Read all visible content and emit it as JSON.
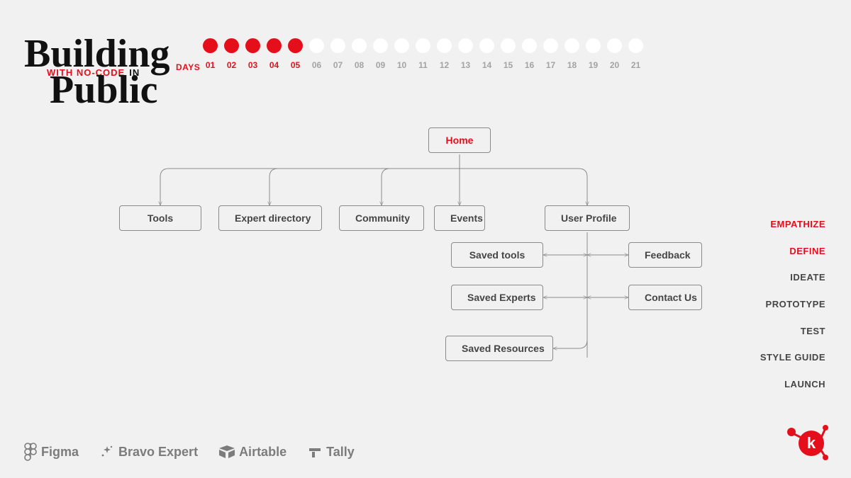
{
  "logo": {
    "line1": "Building",
    "with_nocode": "WITH NO-CODE",
    "in": "IN",
    "line2": "Public"
  },
  "days": {
    "caption": "DAYS",
    "items": [
      {
        "num": "01",
        "active": true
      },
      {
        "num": "02",
        "active": true
      },
      {
        "num": "03",
        "active": true
      },
      {
        "num": "04",
        "active": true
      },
      {
        "num": "05",
        "active": true
      },
      {
        "num": "06",
        "active": false
      },
      {
        "num": "07",
        "active": false
      },
      {
        "num": "08",
        "active": false
      },
      {
        "num": "09",
        "active": false
      },
      {
        "num": "10",
        "active": false
      },
      {
        "num": "11",
        "active": false
      },
      {
        "num": "12",
        "active": false
      },
      {
        "num": "13",
        "active": false
      },
      {
        "num": "14",
        "active": false
      },
      {
        "num": "15",
        "active": false
      },
      {
        "num": "16",
        "active": false
      },
      {
        "num": "17",
        "active": false
      },
      {
        "num": "18",
        "active": false
      },
      {
        "num": "19",
        "active": false
      },
      {
        "num": "20",
        "active": false
      },
      {
        "num": "21",
        "active": false
      }
    ]
  },
  "phases": [
    {
      "label": "EMPATHIZE",
      "active": true
    },
    {
      "label": "DEFINE",
      "active": true
    },
    {
      "label": "IDEATE",
      "active": false
    },
    {
      "label": "PROTOTYPE",
      "active": false
    },
    {
      "label": "TEST",
      "active": false
    },
    {
      "label": "STYLE GUIDE",
      "active": false
    },
    {
      "label": "LAUNCH",
      "active": false
    }
  ],
  "diagram": {
    "root": "Home",
    "level1": {
      "tools": "Tools",
      "experts": "Expert directory",
      "community": "Community",
      "events": "Events",
      "user_profile": "User Profile"
    },
    "user_profile_children": {
      "saved_tools": "Saved tools",
      "feedback": "Feedback",
      "saved_experts": "Saved Experts",
      "contact_us": "Contact Us",
      "saved_resources": "Saved Resources"
    }
  },
  "footer_tools": {
    "figma": "Figma",
    "bravo": "Bravo Expert",
    "airtable": "Airtable",
    "tally": "Tally"
  },
  "colors": {
    "accent": "#e40f1b",
    "bg": "#f1f1f1",
    "text": "#454545",
    "muted": "#a3a3a3",
    "border": "#8a8a8a"
  }
}
